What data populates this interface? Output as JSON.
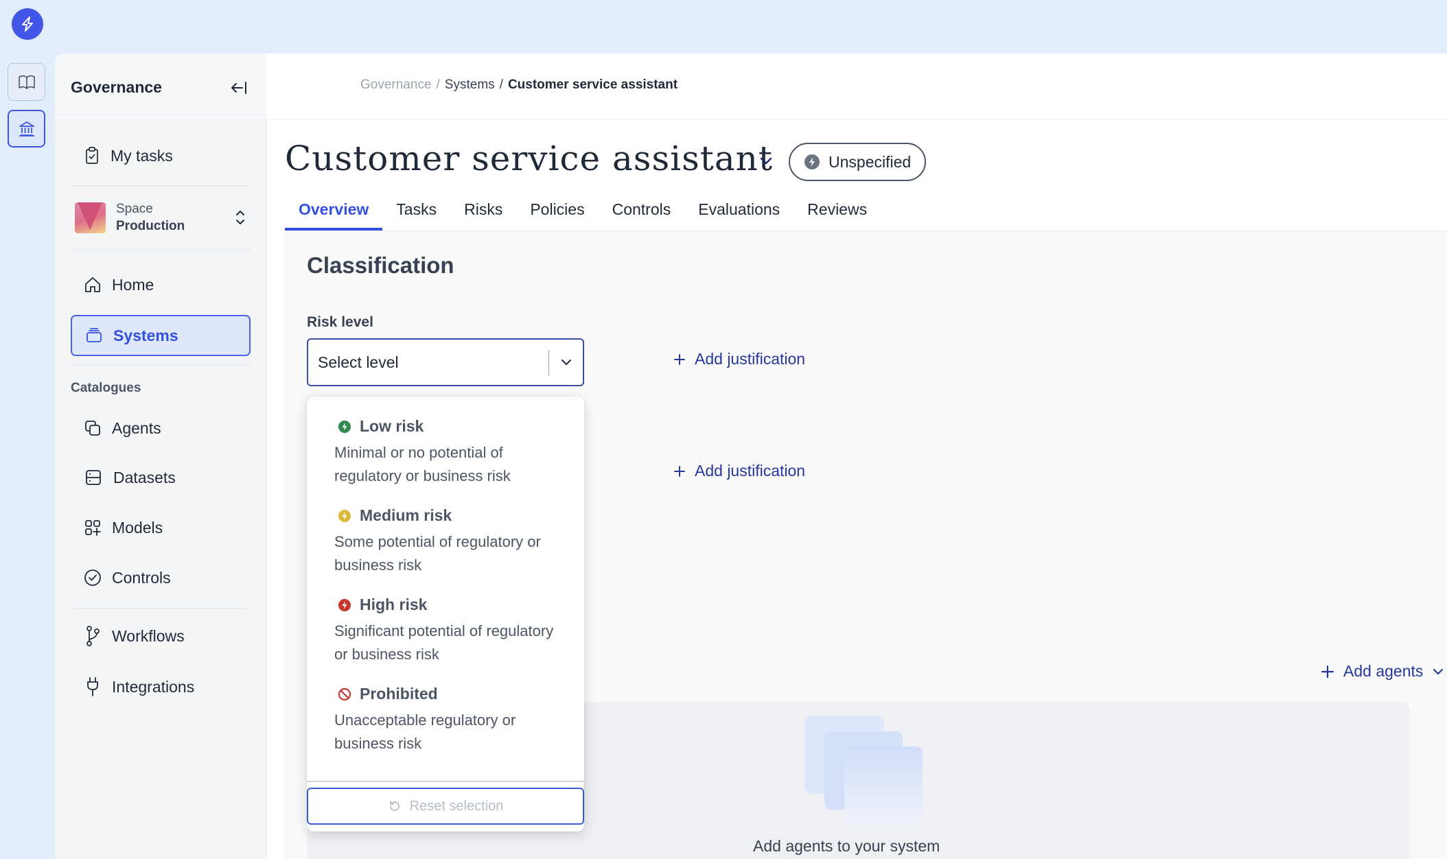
{
  "app": {
    "section_title": "Governance"
  },
  "sidebar": {
    "my_tasks": "My tasks",
    "space": {
      "label": "Space",
      "value": "Production"
    },
    "nav": [
      {
        "label": "Home",
        "icon": "home-icon"
      },
      {
        "label": "Systems",
        "icon": "systems-icon",
        "active": true
      }
    ],
    "catalogues_label": "Catalogues",
    "catalogues": [
      {
        "label": "Agents",
        "icon": "agents-icon"
      },
      {
        "label": "Datasets",
        "icon": "datasets-icon"
      },
      {
        "label": "Models",
        "icon": "models-icon"
      },
      {
        "label": "Controls",
        "icon": "controls-icon"
      }
    ],
    "bottom": [
      {
        "label": "Workflows",
        "icon": "workflows-icon"
      },
      {
        "label": "Integrations",
        "icon": "integrations-icon"
      }
    ]
  },
  "breadcrumb": {
    "root": "Governance",
    "sep": "/",
    "parent": "Systems",
    "current": "Customer service assistant"
  },
  "page": {
    "title": "Customer service assistant",
    "status": "Unspecified",
    "tabs": [
      "Overview",
      "Tasks",
      "Risks",
      "Policies",
      "Controls",
      "Evaluations",
      "Reviews"
    ],
    "active_tab": "Overview"
  },
  "classification": {
    "heading": "Classification",
    "risk_label": "Risk level",
    "risk_placeholder": "Select level",
    "add_justification": "Add justification"
  },
  "risk_options": [
    {
      "title": "Low risk",
      "desc": "Minimal or no potential of regulatory or business risk",
      "color": "#2f8a4f"
    },
    {
      "title": "Medium risk",
      "desc": "Some potential of regulatory or business risk",
      "color": "#d9b93a"
    },
    {
      "title": "High risk",
      "desc": "Significant potential of regulatory or business risk",
      "color": "#c8372d"
    },
    {
      "title": "Prohibited",
      "desc": "Unacceptable regulatory or business risk",
      "color": "#c8372d"
    }
  ],
  "reset_label": "Reset selection",
  "agents": {
    "add_label": "Add agents",
    "empty_text": "Add agents to your system"
  },
  "colors": {
    "accent": "#3450e0",
    "link": "#24379b",
    "rail_bg": "#e3edfb"
  }
}
